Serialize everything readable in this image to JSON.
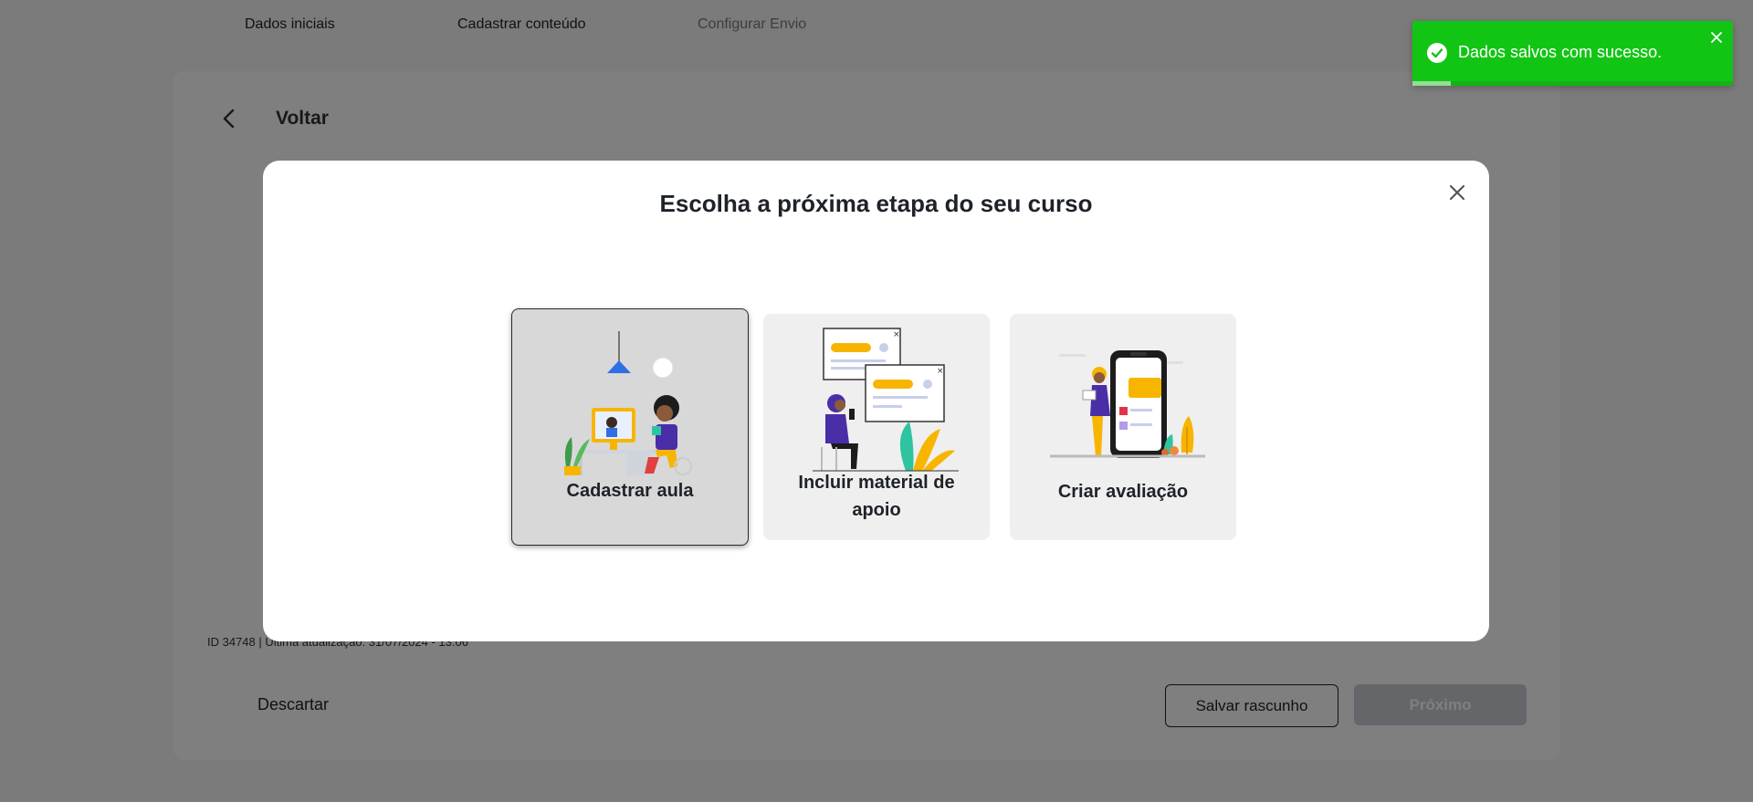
{
  "steps": [
    {
      "label": "Dados iniciais",
      "state": "done"
    },
    {
      "label": "Cadastrar conteúdo",
      "state": "current"
    },
    {
      "label": "Configurar Envio",
      "state": "pending"
    }
  ],
  "card": {
    "back_label": "Voltar",
    "meta_line": "ID 34748 | Última atualização: 31/07/2024 - 13:06",
    "discard_label": "Descartar",
    "draft_label": "Salvar rascunho",
    "next_label": "Próximo"
  },
  "modal": {
    "title": "Escolha a próxima etapa do seu curso",
    "options": [
      {
        "label": "Cadastrar aula",
        "icon": "classroom-illustration",
        "selected": true
      },
      {
        "label": "Incluir material de apoio",
        "icon": "support-material-illustration",
        "selected": false
      },
      {
        "label": "Criar avaliação",
        "icon": "assessment-illustration",
        "selected": false
      }
    ]
  },
  "toast": {
    "message": "Dados salvos com sucesso.",
    "progress": 0.12,
    "color": "#12c514"
  },
  "colors": {
    "accent_blue": "#2f6fe4",
    "accent_yellow": "#f7b500",
    "accent_purple": "#4a2ea8"
  }
}
